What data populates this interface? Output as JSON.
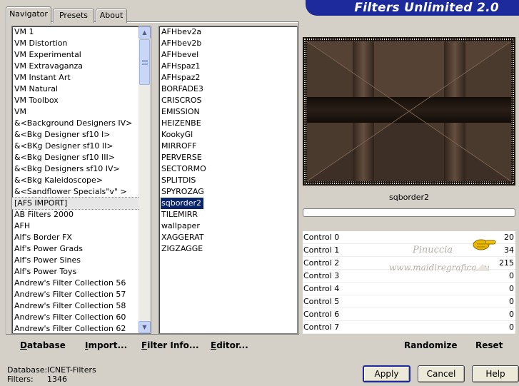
{
  "header": {
    "banner_title": "Filters Unlimited 2.0"
  },
  "tabs": [
    {
      "label": "Navigator",
      "active": true
    },
    {
      "label": "Presets",
      "active": false
    },
    {
      "label": "About",
      "active": false
    }
  ],
  "category_list": {
    "items": [
      "VM 1",
      "VM Distortion",
      "VM Experimental",
      "VM Extravaganza",
      "VM Instant Art",
      "VM Natural",
      "VM Toolbox",
      "VM",
      "&<Background Designers IV>",
      "&<Bkg Designer sf10 I>",
      "&<BKg Designer sf10 II>",
      "&<Bkg Designer sf10 III>",
      "&<Bkg Designers sf10 IV>",
      "&<Bkg Kaleidoscope>",
      "&<Sandflower Specials\"v\" >",
      "[AFS IMPORT]",
      "AB Filters 2000",
      "AFH",
      "Alf's Border FX",
      "Alf's Power Grads",
      "Alf's Power Sines",
      "Alf's Power Toys",
      "Andrew's Filter Collection 56",
      "Andrew's Filter Collection 57",
      "Andrew's Filter Collection 58",
      "Andrew's Filter Collection 60",
      "Andrew's Filter Collection 62"
    ],
    "selected": "[AFS IMPORT]"
  },
  "filter_list": {
    "items": [
      "AFHbev2a",
      "AFHbev2b",
      "AFHbevel",
      "AFHspaz1",
      "AFHspaz2",
      "BORFADE3",
      "CRISCROS",
      "EMISSION",
      "HEIZENBE",
      "KookyGl",
      "MIRROFF",
      "PERVERSE",
      "SECTORMO",
      "SPLITDIS",
      "SPYROZAG",
      "sqborder2",
      "TILEMIRR",
      "wallpaper",
      "XAGGERAT",
      "ZIGZAGGE"
    ],
    "selected": "sqborder2"
  },
  "bottom_links": {
    "database": "Database",
    "import": "Import...",
    "filter_info": "Filter Info...",
    "editor": "Editor..."
  },
  "preview": {
    "filter_name": "sqborder2"
  },
  "watermark": {
    "line1": "Pinuccia",
    "line2": "www.maidiregrafica.eu"
  },
  "controls": [
    {
      "label": "Control 0",
      "value": "20"
    },
    {
      "label": "Control 1",
      "value": "34"
    },
    {
      "label": "Control 2",
      "value": "215"
    },
    {
      "label": "Control 3",
      "value": "0"
    },
    {
      "label": "Control 4",
      "value": "0"
    },
    {
      "label": "Control 5",
      "value": "0"
    },
    {
      "label": "Control 6",
      "value": "0"
    },
    {
      "label": "Control 7",
      "value": "0"
    }
  ],
  "actions": {
    "randomize": "Randomize",
    "reset": "Reset"
  },
  "status": {
    "database_label": "Database:",
    "database_value": "ICNET-Filters",
    "filters_label": "Filters:",
    "filters_value": "1346"
  },
  "dialog_buttons": {
    "apply": "Apply",
    "cancel": "Cancel",
    "help": "Help"
  },
  "colors": {
    "banner": "#1c2a9c",
    "selection": "#0a246a",
    "face": "#d4d0c8"
  }
}
